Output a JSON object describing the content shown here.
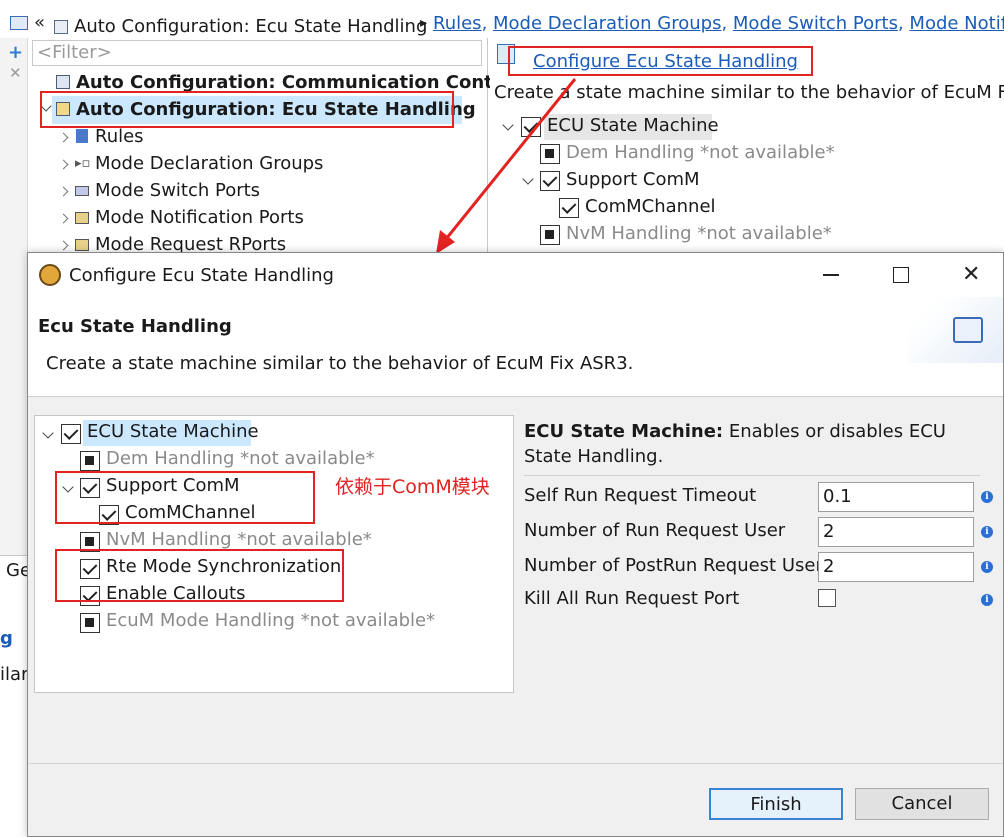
{
  "background": {
    "breadcrumb": {
      "title": "Auto Configuration: Ecu State Handling",
      "links": [
        "Rules",
        "Mode Declaration Groups",
        "Mode Switch Ports",
        "Mode Notific"
      ]
    },
    "filter_placeholder": "<Filter>",
    "tree": {
      "item_comm": "Auto Configuration: Communication Control",
      "item_ecu": "Auto Configuration: Ecu State Handling",
      "children": [
        "Rules",
        "Mode Declaration Groups",
        "Mode Switch Ports",
        "Mode Notification Ports",
        "Mode Request RPorts"
      ]
    },
    "right_panel": {
      "link": "Configure Ecu State Handling",
      "description": "Create a state machine similar to the behavior of EcuM Fix A",
      "items": {
        "ecu": "ECU State Machine",
        "dem": "Dem Handling *not available*",
        "comm": "Support ComM",
        "channel": "ComMChannel",
        "nvm": "NvM Handling *not available*"
      }
    },
    "left_edge_texts": [
      "Ge",
      "g",
      "ilar"
    ]
  },
  "dialog": {
    "title": "Configure Ecu State Handling",
    "section_title": "Ecu State Handling",
    "description": "Create a state machine similar to the behavior of EcuM Fix ASR3.",
    "tree": {
      "ecu": "ECU State Machine",
      "dem": "Dem Handling *not available*",
      "comm": "Support ComM",
      "channel": "ComMChannel",
      "nvm": "NvM Handling *not available*",
      "rte": "Rte Mode Synchronization",
      "callouts": "Enable Callouts",
      "ecum": "EcuM Mode Handling *not available*"
    },
    "annotation": "依赖于ComM模块",
    "details": {
      "heading_bold": "ECU State Machine:",
      "heading_text": " Enables or disables ECU State Handling.",
      "fields": [
        {
          "label": "Self Run Request Timeout",
          "value": "0.1"
        },
        {
          "label": "Number of Run Request User",
          "value": "2"
        },
        {
          "label": "Number of PostRun Request User",
          "value": "2"
        },
        {
          "label": "Kill All Run Request Port",
          "value": ""
        }
      ]
    },
    "buttons": {
      "finish": "Finish",
      "cancel": "Cancel"
    }
  },
  "colors": {
    "annotation_red": "#e32222",
    "link_blue": "#1a5cb8",
    "selection": "#cce8ff"
  }
}
